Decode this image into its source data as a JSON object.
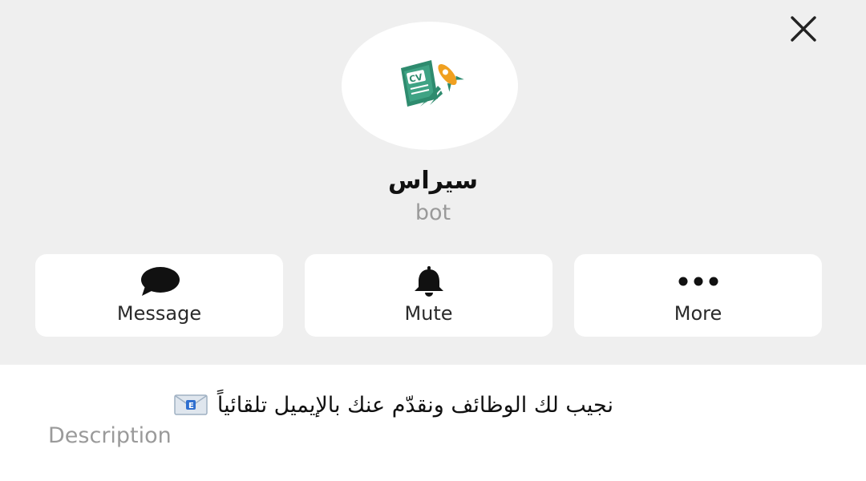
{
  "profile": {
    "name": "سيراس",
    "role": "bot",
    "avatar_icon": "cv-rocket-logo-icon"
  },
  "actions": [
    {
      "label": "Message",
      "icon": "chat-bubble-icon"
    },
    {
      "label": "Mute",
      "icon": "bell-icon"
    },
    {
      "label": "More",
      "icon": "more-dots-icon"
    }
  ],
  "about": {
    "description_text": "نجيب لك الوظائف ونقدّم عنك بالإيميل تلقائياً",
    "description_icon": "envelope-icon",
    "description_label": "Description"
  },
  "colors": {
    "header_bg": "#efefef",
    "card_bg": "#ffffff",
    "logo_green": "#2e8b6e",
    "logo_orange": "#f0a020",
    "muted_text": "#9a9a9a"
  }
}
